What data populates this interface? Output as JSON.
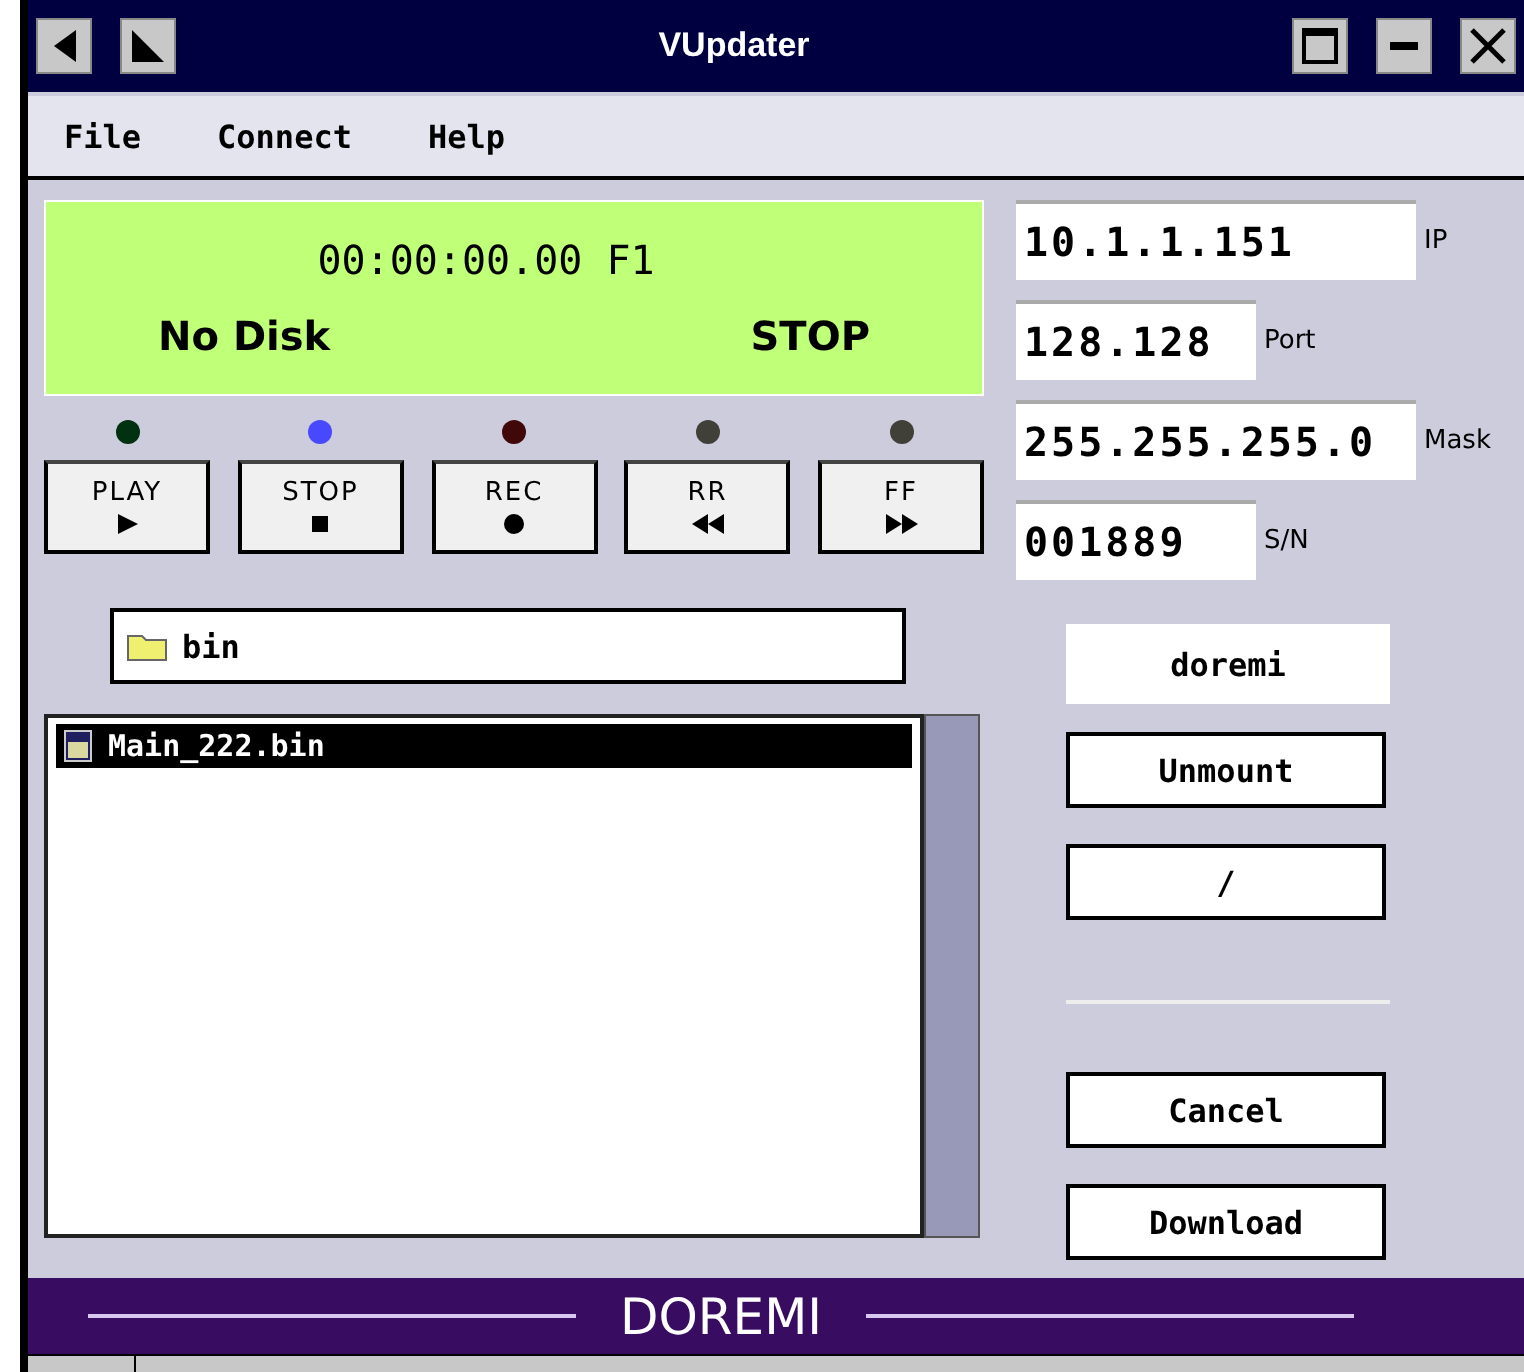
{
  "window": {
    "title": "VUpdater"
  },
  "menu": [
    "File",
    "Connect",
    "Help"
  ],
  "display": {
    "time": "00:00:00.00 F1",
    "disk": "No Disk",
    "mode": "STOP"
  },
  "transport": [
    {
      "label": "PLAY",
      "kind": "play",
      "color": "#003010"
    },
    {
      "label": "STOP",
      "kind": "stop",
      "color": "#4848ff"
    },
    {
      "label": "REC",
      "kind": "rec",
      "color": "#400808"
    },
    {
      "label": "RR",
      "kind": "rewind",
      "color": "#404038"
    },
    {
      "label": "FF",
      "kind": "forward",
      "color": "#404038"
    }
  ],
  "fields": [
    {
      "value": "10.1.1.151",
      "label": "IP",
      "kind": "wide"
    },
    {
      "value": "128.128",
      "label": "Port",
      "kind": "narrow"
    },
    {
      "value": "255.255.255.0",
      "label": "Mask",
      "kind": "wide"
    },
    {
      "value": "001889",
      "label": "S/N",
      "kind": "narrow"
    }
  ],
  "folder": "bin",
  "files": [
    {
      "name": "Main_222.bin",
      "selected": true
    }
  ],
  "volume": "doremi",
  "actions_top": [
    "Unmount",
    "/"
  ],
  "actions_bottom": [
    "Cancel",
    "Download"
  ],
  "footer": "DOREMI"
}
